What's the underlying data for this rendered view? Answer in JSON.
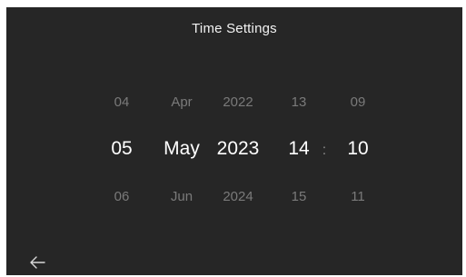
{
  "header": {
    "title": "Time Settings"
  },
  "picker": {
    "day": {
      "prev": "04",
      "selected": "05",
      "next": "06"
    },
    "month": {
      "prev": "Apr",
      "selected": "May",
      "next": "Jun"
    },
    "year": {
      "prev": "2022",
      "selected": "2023",
      "next": "2024"
    },
    "hour": {
      "prev": "13",
      "selected": "14",
      "next": "15"
    },
    "minute": {
      "prev": "09",
      "selected": "10",
      "next": "11"
    },
    "separator": ":"
  },
  "footer": {
    "back_icon": "arrow-left-icon"
  },
  "colors": {
    "background": "#262626",
    "selected_text": "#ffffff",
    "dim_text": "#7a7a7a"
  }
}
